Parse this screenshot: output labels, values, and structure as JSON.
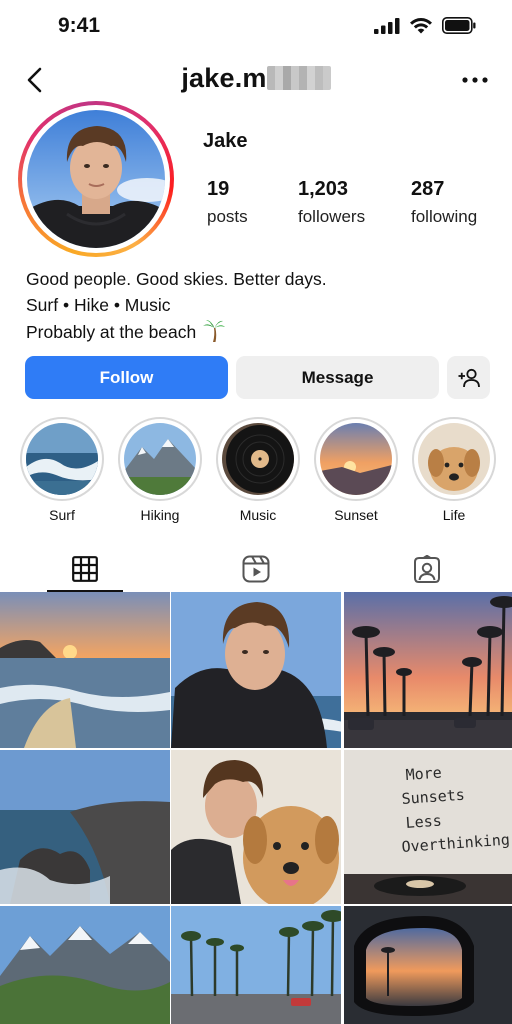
{
  "status_bar": {
    "time": "9:41"
  },
  "header": {
    "username": "jake.m"
  },
  "profile": {
    "display_name": "Jake",
    "stats": {
      "posts": {
        "value": "19",
        "label": "posts"
      },
      "followers": {
        "value": "1,203",
        "label": "followers"
      },
      "following": {
        "value": "287",
        "label": "following"
      }
    },
    "bio": {
      "line1": "Good people. Good skies. Better days.",
      "line2": "Surf • Hike • Music",
      "line3": "Probably at the beach"
    }
  },
  "actions": {
    "follow_label": "Follow",
    "message_label": "Message"
  },
  "highlights": [
    {
      "label": "Surf"
    },
    {
      "label": "Hiking"
    },
    {
      "label": "Music"
    },
    {
      "label": "Sunset"
    },
    {
      "label": "Life"
    }
  ],
  "grid_text": {
    "wall_note": [
      "More",
      "Sunsets",
      "Less",
      "Overthinking"
    ]
  },
  "colors": {
    "accent": "#2f7cf6",
    "button_gray": "#efefef"
  },
  "icons": [
    "back-arrow-icon",
    "more-dots-icon",
    "add-person-icon",
    "grid-icon",
    "reels-icon",
    "tagged-icon",
    "palm-tree-icon"
  ]
}
